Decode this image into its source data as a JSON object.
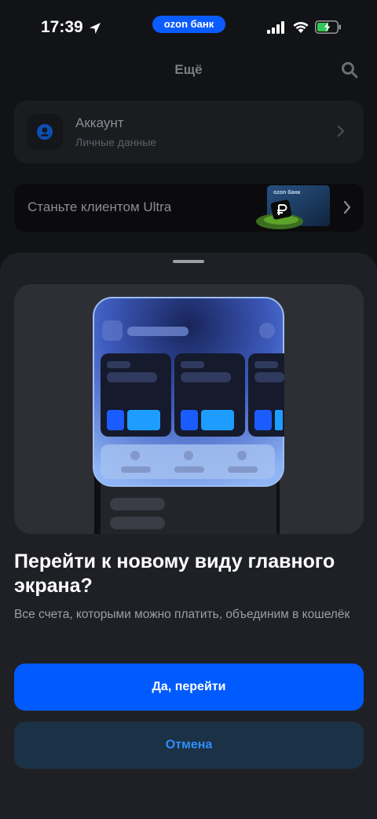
{
  "status_bar": {
    "time": "17:39",
    "brand_pill": "ozon банк",
    "icons": [
      "location-arrow-icon",
      "cellular-signal-icon",
      "wifi-icon",
      "battery-charging-icon"
    ]
  },
  "background_screen": {
    "title": "Ещё",
    "search_icon": "search-icon",
    "account": {
      "title": "Аккаунт",
      "subtitle": "Личные данные",
      "icon": "user-icon"
    },
    "ultra_banner": {
      "text": "Станьте клиентом Ultra",
      "card_brand": "ozon банк"
    }
  },
  "sheet": {
    "title": "Перейти к новому виду главного экрана?",
    "description": "Все счета, которыми можно платить, объединим в кошелёк",
    "primary_button": "Да, перейти",
    "secondary_button": "Отмена"
  },
  "colors": {
    "accent": "#005bff",
    "secondary_button_bg": "#1b3145",
    "secondary_button_text": "#2e8fff",
    "sheet_bg": "#1f2025",
    "screen_bg": "#121316"
  }
}
